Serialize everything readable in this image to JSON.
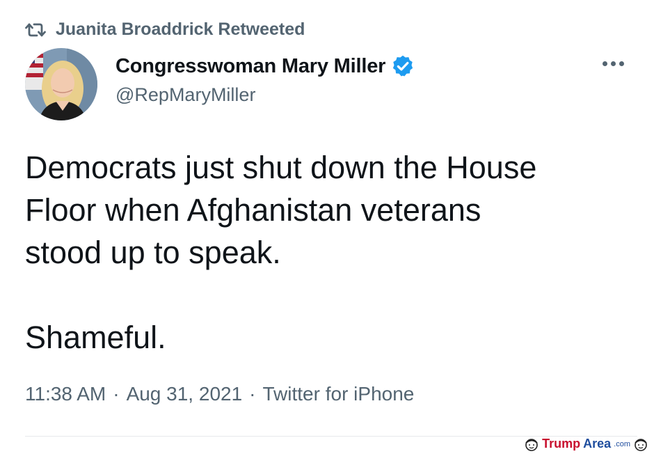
{
  "retweet": {
    "icon": "retweet-icon",
    "label": "Juanita Broaddrick Retweeted"
  },
  "author": {
    "name": "Congresswoman Mary Miller",
    "handle": "@RepMaryMiller",
    "verified": true,
    "verified_color": "#1d9bf0"
  },
  "tweet": {
    "text": "Democrats just shut down the House\nFloor when Afghanistan veterans\nstood up to speak.\n\nShameful."
  },
  "meta": {
    "time": "11:38 AM",
    "date": "Aug 31, 2021",
    "source": "Twitter for iPhone",
    "separator": "·"
  },
  "watermark": {
    "part1": "Trump",
    "part2": "Area",
    "part3": ".com"
  },
  "colors": {
    "text_primary": "#0f1419",
    "text_secondary": "#536471",
    "verified_blue": "#1d9bf0"
  }
}
